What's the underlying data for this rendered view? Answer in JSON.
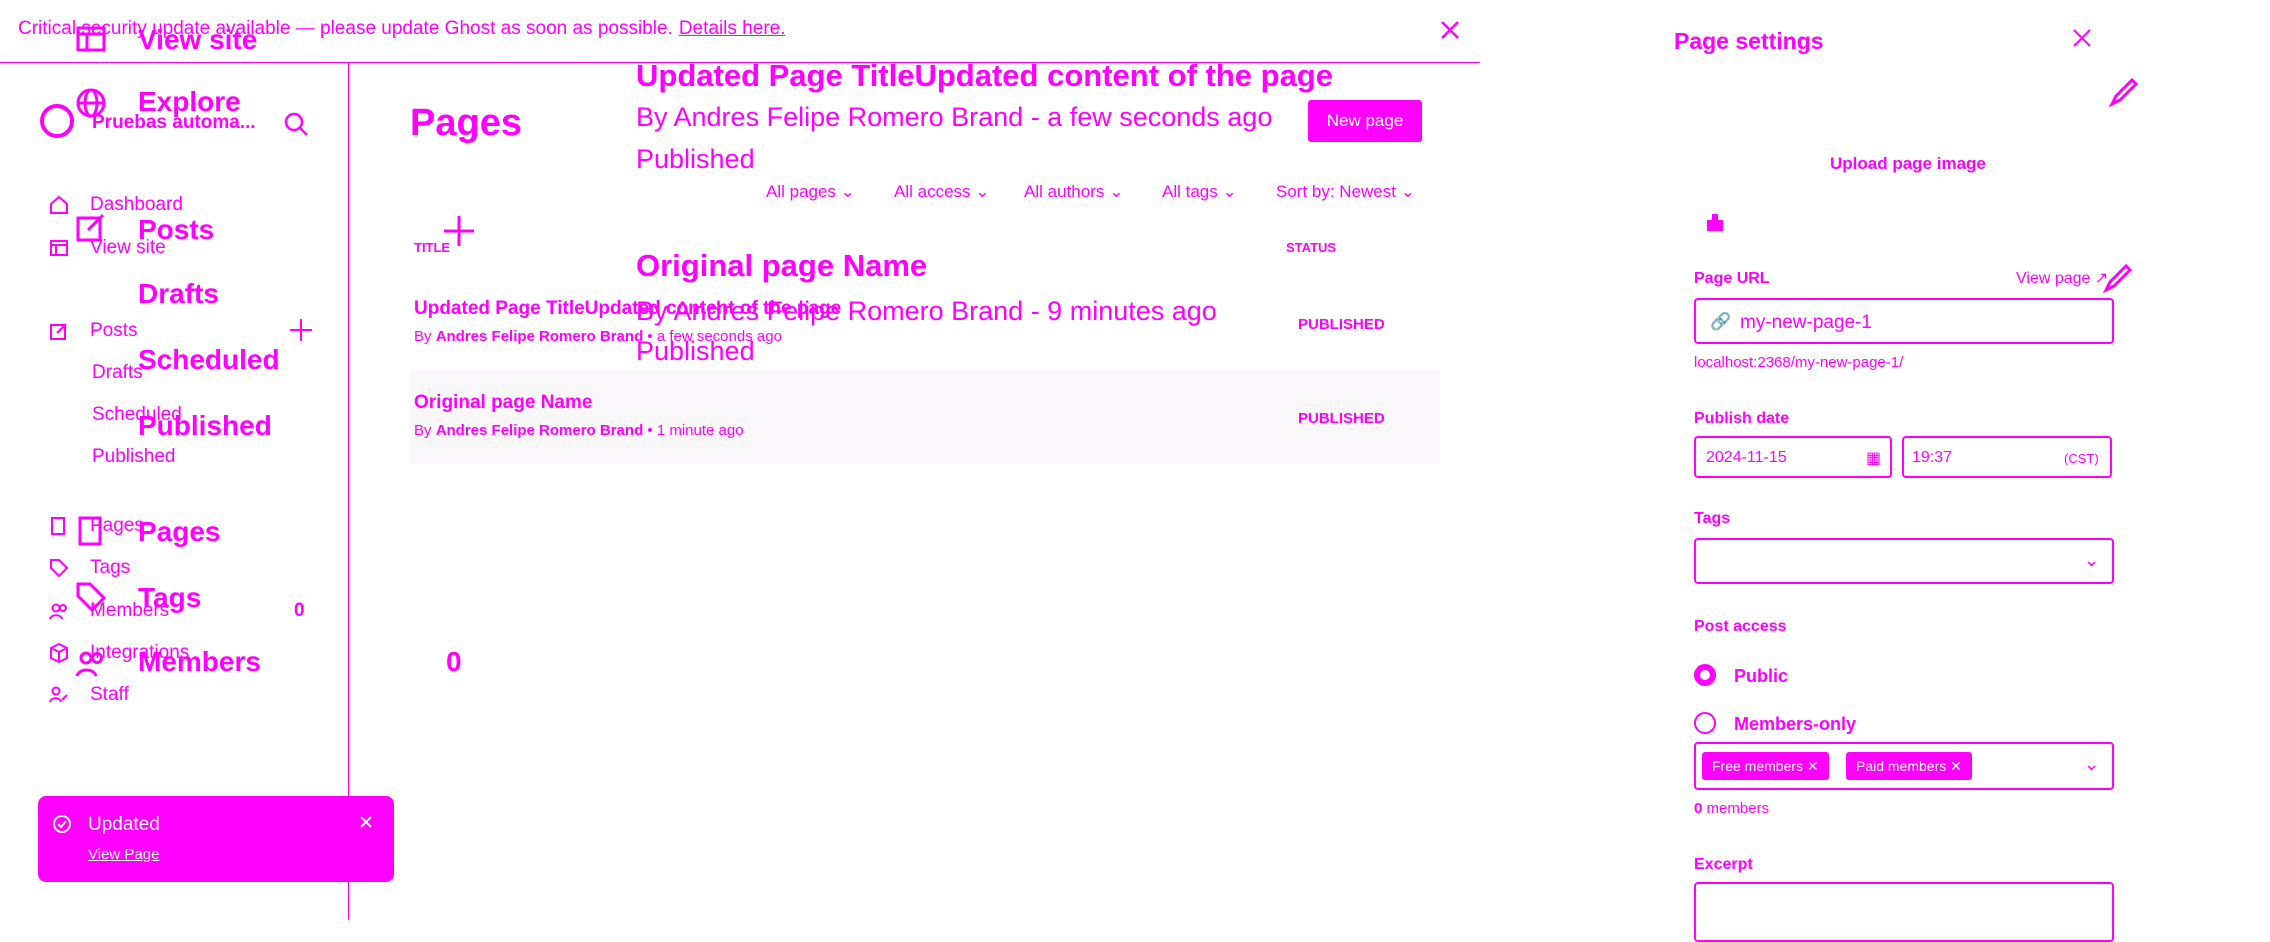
{
  "banner": {
    "text": "Critical security update available — please update Ghost as soon as possible.",
    "link": "Details here."
  },
  "sidebar": {
    "site_name": "Pruebas automa...",
    "nav": [
      "Dashboard",
      "View site",
      "Posts",
      "Drafts",
      "Scheduled",
      "Published",
      "Pages",
      "Tags",
      "Members",
      "Integrations",
      "Staff"
    ],
    "members_count": "0",
    "overlay_nav": [
      "View site",
      "Explore",
      "Posts",
      "Drafts",
      "Scheduled",
      "Published",
      "Pages",
      "Tags",
      "Members"
    ],
    "overlay_members_count": "0"
  },
  "toast": {
    "title": "Updated",
    "link": "View Page"
  },
  "main": {
    "title": "Pages",
    "new_button": "New page",
    "filters": [
      "All pages",
      "All access",
      "All authors",
      "All tags",
      "Sort by: Newest"
    ],
    "col_title": "TITLE",
    "col_status": "STATUS",
    "rows": [
      {
        "title": "Updated Page TitleUpdated content of the page",
        "by": "By",
        "author": "Andres Felipe Romero Brand",
        "time": "• a few seconds ago",
        "status": "PUBLISHED"
      },
      {
        "title": "Original page Name",
        "by": "By",
        "author": "Andres Felipe Romero Brand",
        "time": "• 1 minute ago",
        "status": "PUBLISHED"
      }
    ],
    "overlay": {
      "row1_title": "Updated Page TitleUpdated content of the page",
      "row1_meta": "By Andres Felipe Romero Brand - a few seconds ago",
      "row1_status": "Published",
      "row2_title": "Original page Name",
      "row2_meta": "By Andres Felipe Romero Brand - 9 minutes ago",
      "row2_status": "Published"
    }
  },
  "settings": {
    "title": "Page settings",
    "upload": "Upload page image",
    "url_label": "Page URL",
    "view_page": "View page",
    "slug": "my-new-page-1",
    "full_url": "localhost:2368/my-new-page-1/",
    "publish_label": "Publish date",
    "date": "2024-11-15",
    "time": "19:37",
    "tz": "(CST)",
    "tags_label": "Tags",
    "access_label": "Post access",
    "public": "Public",
    "members_only": "Members-only",
    "chips": [
      "Free members",
      "Paid members"
    ],
    "members_count": "0",
    "members_word": "members",
    "excerpt_label": "Excerpt"
  }
}
